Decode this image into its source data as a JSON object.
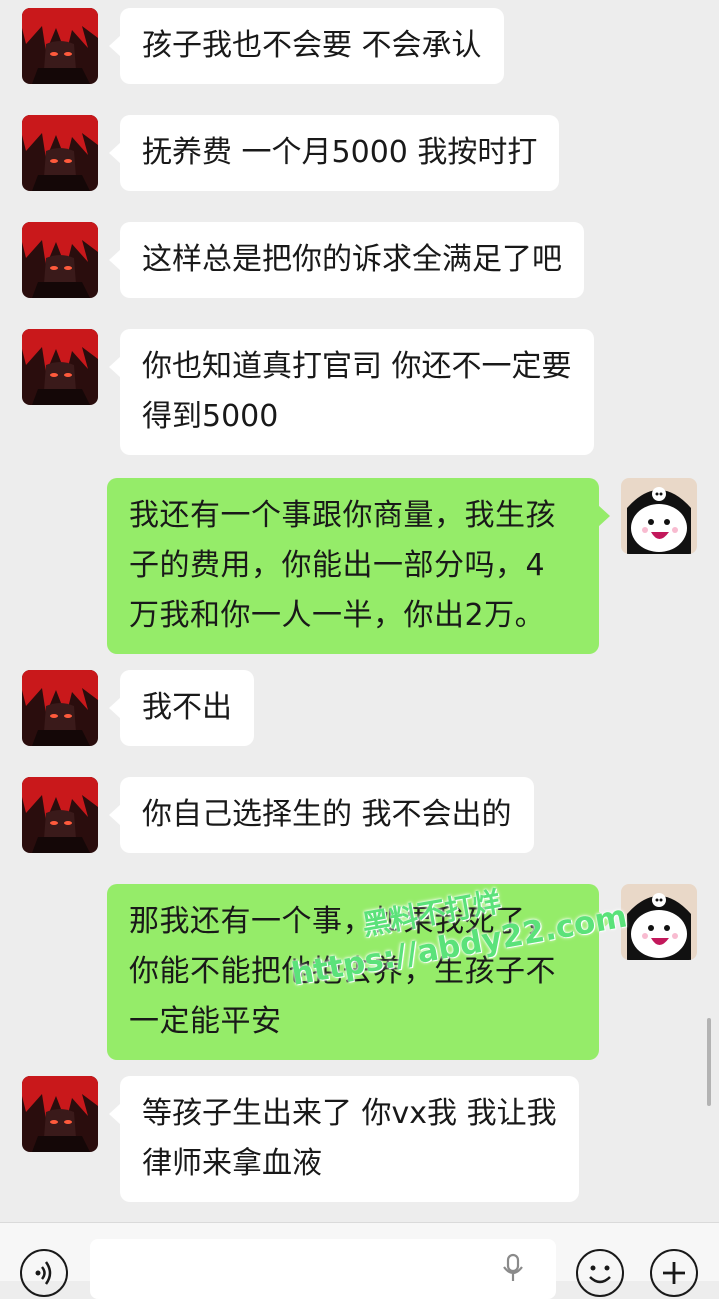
{
  "messages": [
    {
      "side": "left",
      "avatar": "red-hair-anime-avatar",
      "text": "孩子我也不会要 不会承认"
    },
    {
      "side": "left",
      "avatar": "red-hair-anime-avatar",
      "text": "抚养费 一个月5000 我按时打"
    },
    {
      "side": "left",
      "avatar": "red-hair-anime-avatar",
      "text": "这样总是把你的诉求全满足了吧"
    },
    {
      "side": "left",
      "avatar": "red-hair-anime-avatar",
      "text": "你也知道真打官司 你还不一定要\n得到5000"
    },
    {
      "side": "right",
      "avatar": "kuromi-avatar",
      "text": "我还有一个事跟你商量，我生孩\n子的费用，你能出一部分吗，4\n万我和你一人一半，你出2万。"
    },
    {
      "side": "left",
      "avatar": "red-hair-anime-avatar",
      "text": "我不出"
    },
    {
      "side": "left",
      "avatar": "red-hair-anime-avatar",
      "text": "你自己选择生的 我不会出的"
    },
    {
      "side": "right",
      "avatar": "kuromi-avatar",
      "text": "那我还有一个事，如果我死了，\n你能不能把他抱去养，生孩子不\n一定能平安"
    },
    {
      "side": "left",
      "avatar": "red-hair-anime-avatar",
      "text": "等孩子生出来了 你vx我 我让我\n律师来拿血液"
    }
  ],
  "watermark": {
    "line1": "黑料不打烊",
    "line2": "https://abdy22.com"
  },
  "input_bar": {
    "voice_icon": "voice-icon",
    "mic_icon": "microphone-icon",
    "emoji_icon": "emoji-icon",
    "plus_icon": "plus-icon",
    "placeholder": ""
  },
  "colors": {
    "background": "#ededed",
    "incoming_bubble": "#ffffff",
    "outgoing_bubble": "#95ec69",
    "watermark": "#5be27a"
  }
}
